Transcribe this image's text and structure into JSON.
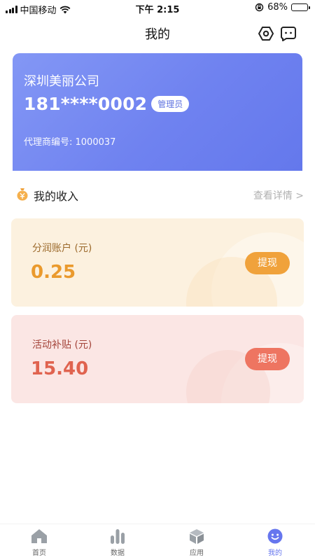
{
  "status_bar": {
    "carrier": "中国移动",
    "time": "下午 2:15",
    "battery": "68%",
    "battery_level": 0.68
  },
  "header": {
    "title": "我的",
    "settings_icon": "settings-hex-icon",
    "message_icon": "message-icon"
  },
  "profile": {
    "company": "深圳美丽公司",
    "phone": "181****0002",
    "role": "管理员",
    "agent_no": "代理商编号: 1000037"
  },
  "income": {
    "icon": "money-bag-icon",
    "title": "我的收入",
    "detail_link": "查看详情 >",
    "cards": [
      {
        "label": "分润账户 (元)",
        "amount": "0.25",
        "button": "提现",
        "color": "#ea9a2d"
      },
      {
        "label": "活动补贴 (元)",
        "amount": "15.40",
        "button": "提现",
        "color": "#e0634f"
      }
    ]
  },
  "tab_bar": {
    "items": [
      {
        "label": "首页",
        "icon": "home-icon",
        "active": false
      },
      {
        "label": "数据",
        "icon": "bar-chart-icon",
        "active": false
      },
      {
        "label": "应用",
        "icon": "cube-icon",
        "active": false
      },
      {
        "label": "我的",
        "icon": "smile-icon",
        "active": true
      }
    ],
    "active_color": "#6676ee",
    "inactive_color": "#9aa0a6"
  }
}
